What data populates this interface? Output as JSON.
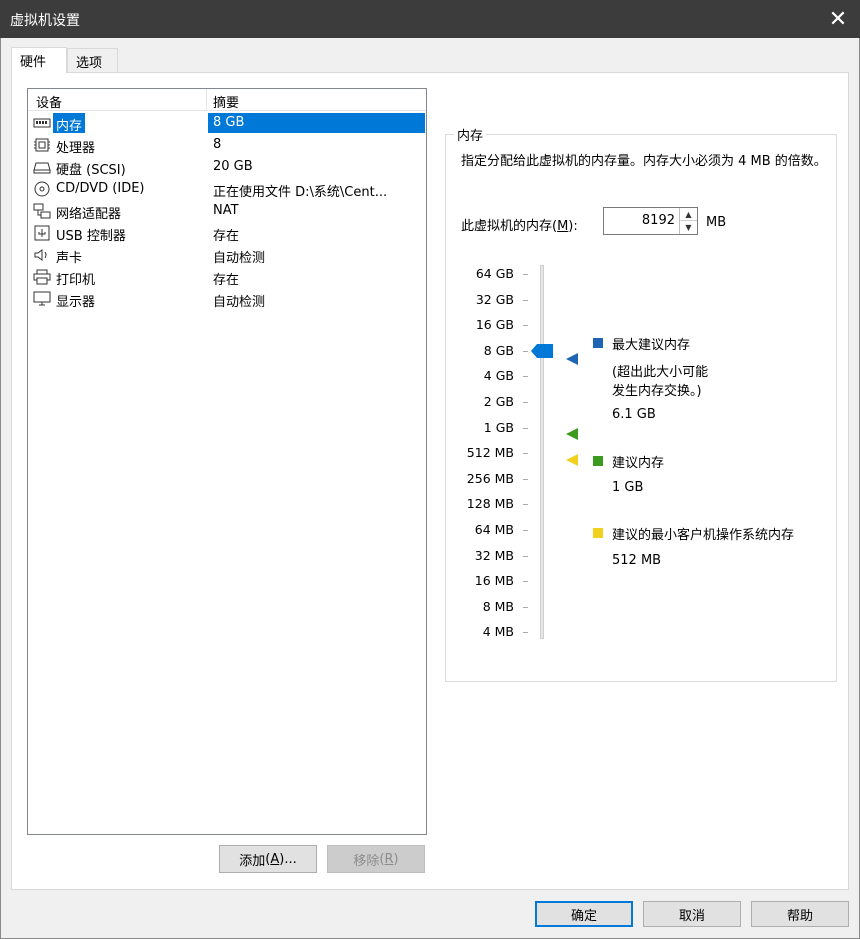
{
  "window": {
    "title": "虚拟机设置",
    "close_icon": "close-icon"
  },
  "tabs": [
    {
      "label": "硬件"
    },
    {
      "label": "选项"
    }
  ],
  "device_list": {
    "columns": {
      "device": "设备",
      "summary": "摘要"
    },
    "rows": [
      {
        "name": "内存",
        "summary": "8 GB",
        "icon": "memory-icon"
      },
      {
        "name": "处理器",
        "summary": "8",
        "icon": "cpu-icon"
      },
      {
        "name": "硬盘 (SCSI)",
        "summary": "20 GB",
        "icon": "hard-disk-icon"
      },
      {
        "name": "CD/DVD (IDE)",
        "summary": "正在使用文件 D:\\系统\\Cent...",
        "icon": "cd-dvd-icon"
      },
      {
        "name": "网络适配器",
        "summary": "NAT",
        "icon": "network-adapter-icon"
      },
      {
        "name": "USB 控制器",
        "summary": "存在",
        "icon": "usb-icon"
      },
      {
        "name": "声卡",
        "summary": "自动检测",
        "icon": "speaker-icon"
      },
      {
        "name": "打印机",
        "summary": "存在",
        "icon": "printer-icon"
      },
      {
        "name": "显示器",
        "summary": "自动检测",
        "icon": "monitor-icon"
      }
    ],
    "selected_index": 0
  },
  "buttons": {
    "add": {
      "label": "添加",
      "mnemonic": "A",
      "suffix": "...",
      "open": "(",
      "close": ")"
    },
    "remove": {
      "label": "移除",
      "mnemonic": "R",
      "open": "(",
      "close": ")"
    },
    "ok": "确定",
    "cancel": "取消",
    "help": "帮助"
  },
  "memory": {
    "group_title": "内存",
    "description": "指定分配给此虚拟机的内存量。内存大小必须为 4 MB 的倍数。",
    "input_label_prefix": "此虚拟机的内存(",
    "input_mnemonic": "M",
    "input_label_suffix": "):",
    "value": "8192",
    "unit": "MB",
    "scale": [
      "64 GB",
      "32 GB",
      "16 GB",
      "8 GB",
      "4 GB",
      "2 GB",
      "1 GB",
      "512 MB",
      "256 MB",
      "128 MB",
      "64 MB",
      "32 MB",
      "16 MB",
      "8 MB",
      "4 MB"
    ],
    "current_value": "8 GB",
    "legend": {
      "max_recommended": {
        "title": "最大建议内存",
        "note_line1": "(超出此大小可能",
        "note_line2": "发生内存交换。)",
        "value": "6.1 GB",
        "color": "#1e66b4"
      },
      "recommended": {
        "title": "建议内存",
        "value": "1 GB",
        "color": "#3c9a1e"
      },
      "min_recommended": {
        "title": "建议的最小客户机操作系统内存",
        "value": "512 MB",
        "color": "#f0d21e"
      }
    },
    "thumb_color": "#0078d7"
  }
}
